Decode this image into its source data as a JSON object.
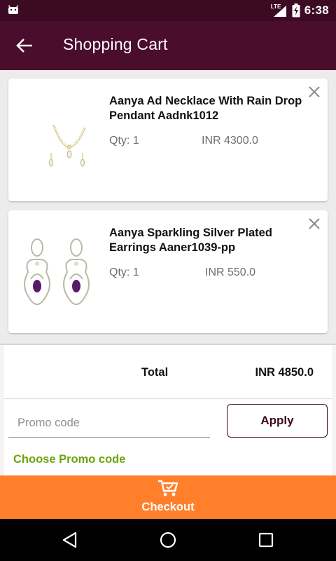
{
  "status_bar": {
    "network": "LTE",
    "time": "6:38",
    "icons": [
      "android-debug-icon",
      "lte-signal-icon",
      "battery-charging-icon"
    ]
  },
  "app_bar": {
    "title": "Shopping Cart",
    "back_icon": "arrow-left-icon"
  },
  "cart": {
    "items": [
      {
        "name": "Aanya Ad Necklace With Rain Drop Pendant Aadnk1012",
        "qty": "Qty: 1",
        "price": "INR 4300.0",
        "image": "necklace-image",
        "remove_icon": "close-icon"
      },
      {
        "name": "Aanya Sparkling Silver Plated Earrings Aaner1039-pp",
        "qty": "Qty: 1",
        "price": "INR 550.0",
        "image": "earrings-image",
        "remove_icon": "close-icon"
      }
    ]
  },
  "summary": {
    "total_label": "Total",
    "total_value": "INR 4850.0",
    "promo_placeholder": "Promo code",
    "promo_value": "",
    "apply_label": "Apply",
    "choose_promo_label": "Choose Promo code"
  },
  "checkout": {
    "label": "Checkout",
    "icon": "cart-checkout-icon"
  },
  "nav": {
    "icons": [
      "back-triangle-icon",
      "home-circle-icon",
      "recents-square-icon"
    ]
  },
  "colors": {
    "app_bar": "#4a0d2c",
    "status_bar": "#3d0a24",
    "checkout": "#ff7f2a",
    "promo_link": "#6aa50c",
    "apply_border": "#3c0a20"
  }
}
